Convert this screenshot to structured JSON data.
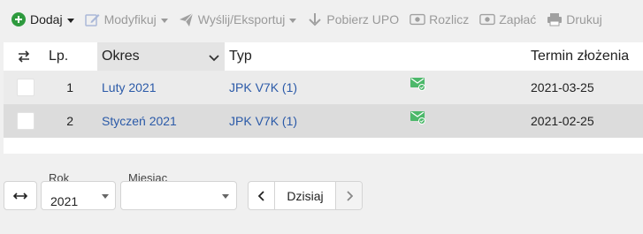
{
  "toolbar": {
    "add_label": "Dodaj",
    "modify_label": "Modyfikuj",
    "send_label": "Wyślij/Eksportuj",
    "upo_label": "Pobierz UPO",
    "settle_label": "Rozlicz",
    "pay_label": "Zapłać",
    "print_label": "Drukuj"
  },
  "table": {
    "columns": {
      "lp": "Lp.",
      "okres": "Okres",
      "typ": "Typ",
      "termin": "Termin złożenia"
    },
    "rows": [
      {
        "lp": "1",
        "okres": "Luty 2021",
        "typ": "JPK V7K (1)",
        "status_icon": "envelope-check-icon",
        "termin": "2021-03-25"
      },
      {
        "lp": "2",
        "okres": "Styczeń 2021",
        "typ": "JPK V7K (1)",
        "status_icon": "envelope-check-icon",
        "termin": "2021-02-25"
      }
    ]
  },
  "filters": {
    "rok_label": "Rok",
    "rok_value": "2021",
    "miesiac_label": "Miesiąc",
    "miesiac_value": "",
    "today_label": "Dzisiaj"
  },
  "colors": {
    "add_green": "#2e9a3e",
    "link_blue": "#2b5aa8",
    "status_green": "#4cb86a"
  }
}
